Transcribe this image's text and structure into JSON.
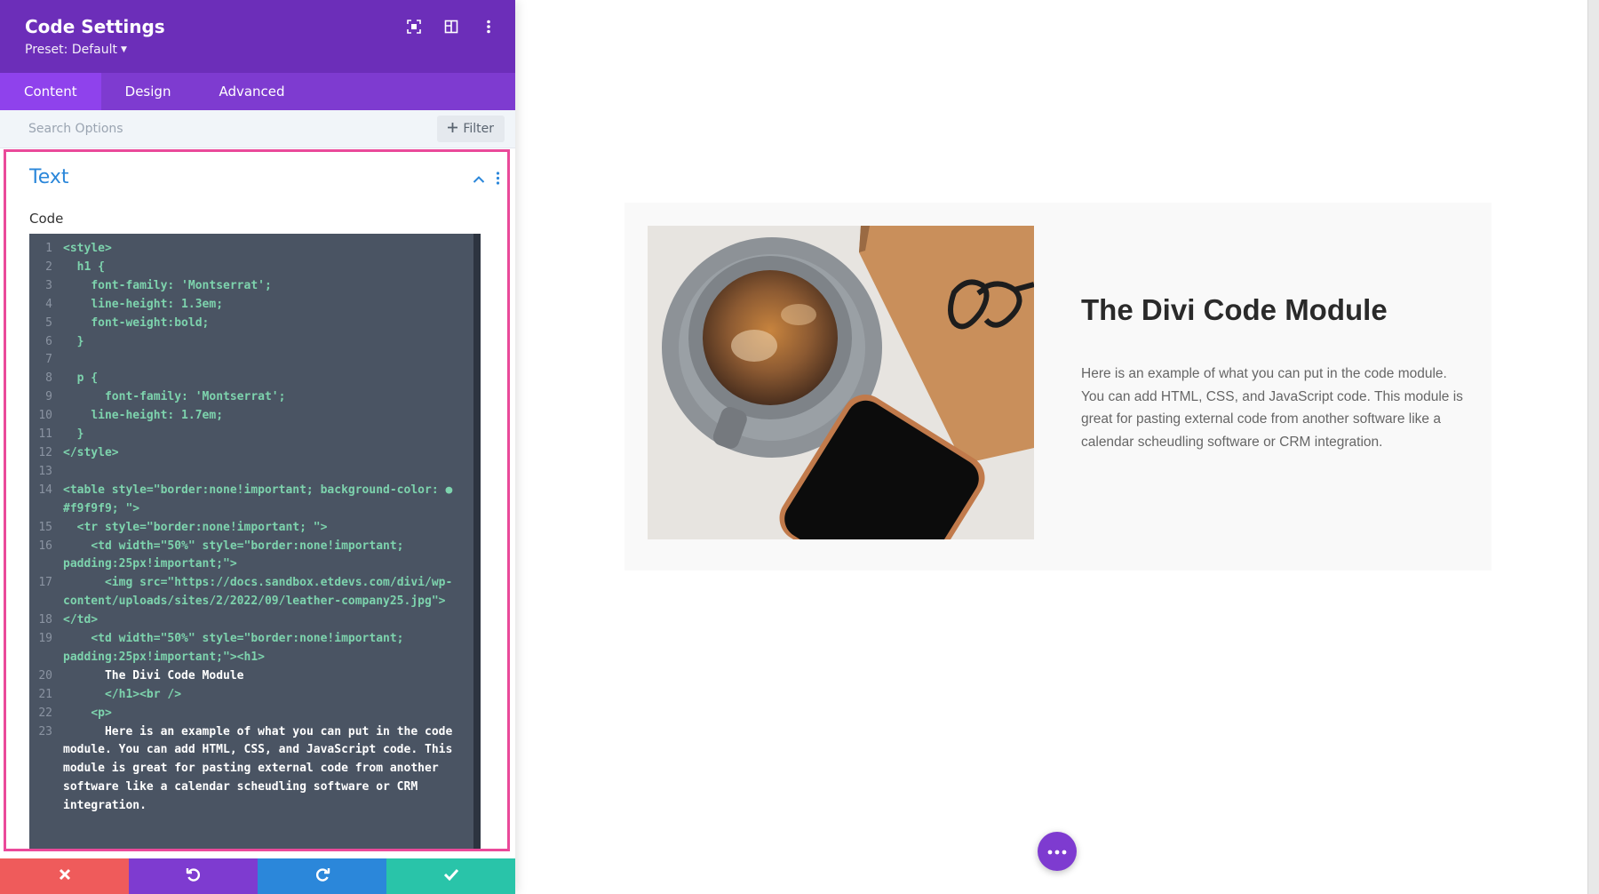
{
  "header": {
    "title": "Code Settings",
    "preset": "Preset: Default",
    "icons": [
      "focus-icon",
      "layout-icon",
      "more-vertical-icon"
    ]
  },
  "tabs": [
    {
      "label": "Content",
      "active": true
    },
    {
      "label": "Design",
      "active": false
    },
    {
      "label": "Advanced",
      "active": false
    }
  ],
  "search": {
    "placeholder": "Search Options",
    "filter_label": "Filter"
  },
  "text_toggle": {
    "title": "Text",
    "field_label": "Code",
    "lines": [
      {
        "n": "1",
        "text": "<style>"
      },
      {
        "n": "2",
        "text": "  h1 {"
      },
      {
        "n": "3",
        "text": "    font-family: 'Montserrat';"
      },
      {
        "n": "4",
        "text": "    line-height: 1.3em;"
      },
      {
        "n": "5",
        "text": "    font-weight:bold;"
      },
      {
        "n": "6",
        "text": "  }"
      },
      {
        "n": "7",
        "text": ""
      },
      {
        "n": "8",
        "text": "  p {"
      },
      {
        "n": "9",
        "text": "      font-family: 'Montserrat';"
      },
      {
        "n": "10",
        "text": "    line-height: 1.7em;"
      },
      {
        "n": "11",
        "text": "  }"
      },
      {
        "n": "12",
        "text": "</style>"
      },
      {
        "n": "13",
        "text": ""
      },
      {
        "n": "14",
        "text": "<table style=\"border:none!important; background-color: ● #f9f9f9; \">"
      },
      {
        "n": "15",
        "text": "  <tr style=\"border:none!important; \">"
      },
      {
        "n": "16",
        "text": "    <td width=\"50%\" style=\"border:none!important; padding:25px!important;\">"
      },
      {
        "n": "17",
        "text": "      <img src=\"https://docs.sandbox.etdevs.com/divi/wp-content/uploads/sites/2/2022/09/leather-company25.jpg\">"
      },
      {
        "n": "18",
        "text": "</td>"
      },
      {
        "n": "19",
        "text": "    <td width=\"50%\" style=\"border:none!important; padding:25px!important;\"><h1>"
      },
      {
        "n": "20",
        "text": "      The Divi Code Module"
      },
      {
        "n": "21",
        "text": "      </h1><br />"
      },
      {
        "n": "22",
        "text": "    <p>"
      },
      {
        "n": "23",
        "text": "      Here is an example of what you can put in the code module. You can add HTML, CSS, and JavaScript code. This module is great for pasting external code from another software like a calendar scheudling software or CRM integration."
      }
    ]
  },
  "bottom_bar": [
    {
      "name": "discard-button",
      "icon": "close-icon",
      "color": "#ef5b5b"
    },
    {
      "name": "undo-button",
      "icon": "undo-icon",
      "color": "#7e3bd0"
    },
    {
      "name": "redo-button",
      "icon": "redo-icon",
      "color": "#2b87da"
    },
    {
      "name": "save-button",
      "icon": "check-icon",
      "color": "#29c4a9"
    }
  ],
  "preview": {
    "heading": "The Divi Code Module",
    "paragraph": "Here is an example of what you can put in the code module. You can add HTML, CSS, and JavaScript code. This module is great for pasting external code from another software like a calendar scheudling software or CRM integration.",
    "image_alt": "coffee-notebook-phone-photo"
  },
  "colors": {
    "header_bg": "#6c2eb9",
    "tabs_bg": "#7e3bd0",
    "active_tab": "#8f42ec",
    "toggle_title": "#2b87da",
    "highlight_border": "#ea4a9a",
    "editor_bg": "#4a5463"
  }
}
